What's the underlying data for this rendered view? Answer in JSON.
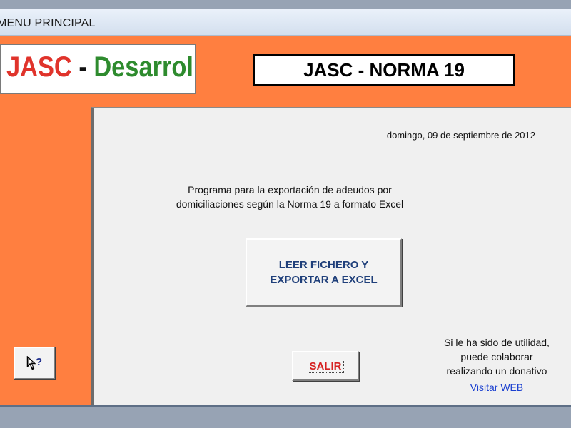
{
  "window": {
    "title": "MENU PRINCIPAL"
  },
  "logo": {
    "part1": "JASC",
    "separator": " - ",
    "part2": "Desarrollo"
  },
  "header": {
    "title": "JASC - NORMA 19"
  },
  "main": {
    "date": "domingo, 09 de septiembre de 2012",
    "description_line1": "Programa para la exportación de adeudos por",
    "description_line2": "domiciliaciones según la Norma 19 a formato Excel",
    "export_button_line1": "LEER FICHERO Y",
    "export_button_line2": "EXPORTAR A EXCEL",
    "exit_button_label": "SALIR",
    "donate_line1": "Si le ha sido de utilidad,",
    "donate_line2": "puede colaborar",
    "donate_line3": "realizando un donativo",
    "web_link": "Visitar WEB"
  },
  "help": {
    "icon": "help-pointer-icon"
  },
  "colors": {
    "background": "#ff7f40",
    "panel": "#f0f0f0",
    "logo_red": "#e0332b",
    "logo_green": "#2e8b2e",
    "export_text": "#1f3f7a",
    "exit_text": "#d62020",
    "link": "#1a3fd0"
  }
}
